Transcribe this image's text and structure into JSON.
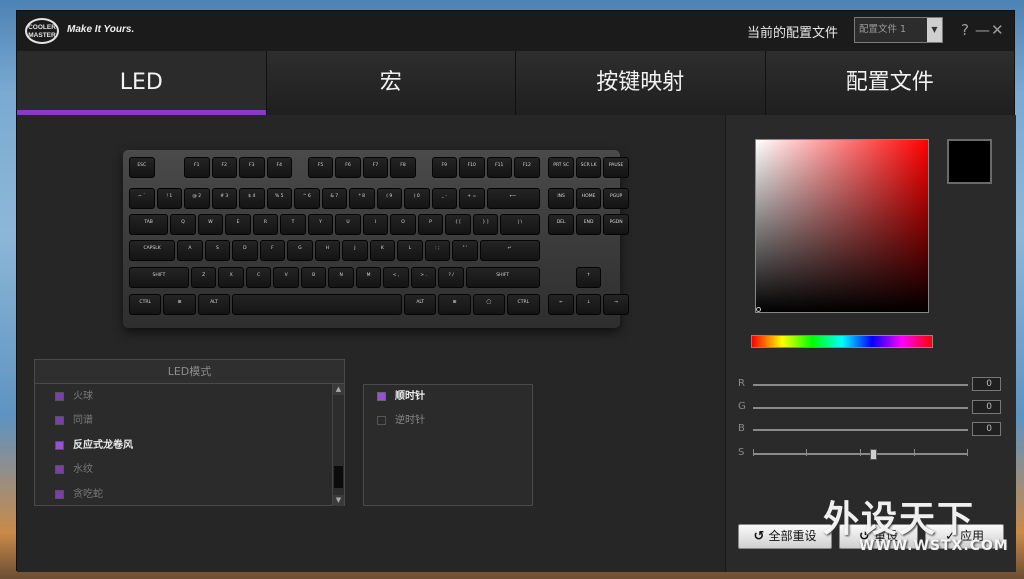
{
  "titlebar": {
    "logo_line1": "COOLER",
    "logo_line2": "MASTER",
    "slogan": "Make It Yours.",
    "profile_label": "当前的配置文件",
    "profile_value": "配置文件 1",
    "help": "?",
    "minimize": "—",
    "close": "✕"
  },
  "tabs": [
    "LED",
    "宏",
    "按键映射",
    "配置文件"
  ],
  "keyboard": {
    "rows": [
      [
        "ESC",
        "F1",
        "F2",
        "F3",
        "F4",
        "F5",
        "F6",
        "F7",
        "F8",
        "F9",
        "F10",
        "F11",
        "F12",
        "PRT SC",
        "SCR LK",
        "PAUSE"
      ],
      [
        "~ `",
        "! 1",
        "@ 2",
        "# 3",
        "$ 4",
        "% 5",
        "^ 6",
        "& 7",
        "* 8",
        "( 9",
        ") 0",
        "_ -",
        "+ =",
        "⟵",
        "INS",
        "HOME",
        "PGUP"
      ],
      [
        "TAB",
        "Q",
        "W",
        "E",
        "R",
        "T",
        "Y",
        "U",
        "I",
        "O",
        "P",
        "{ [",
        "} ]",
        "| \\",
        "DEL",
        "END",
        "PGDN"
      ],
      [
        "CAPSLK",
        "A",
        "S",
        "D",
        "F",
        "G",
        "H",
        "J",
        "K",
        "L",
        ": ;",
        "\" '",
        "↵"
      ],
      [
        "SHIFT",
        "Z",
        "X",
        "C",
        "V",
        "B",
        "N",
        "M",
        "< ,",
        "> .",
        "? /",
        "SHIFT",
        "↑"
      ],
      [
        "CTRL",
        "⊞",
        "ALT",
        "",
        "ALT",
        "⊞",
        "◯",
        "CTRL",
        "←",
        "↓",
        "→"
      ]
    ]
  },
  "led_mode": {
    "header": "LED模式",
    "items": [
      {
        "label": "火球",
        "selected": false
      },
      {
        "label": "同谱",
        "selected": false
      },
      {
        "label": "反应式龙卷风",
        "selected": true
      },
      {
        "label": "水纹",
        "selected": false
      },
      {
        "label": "贪吃蛇",
        "selected": false
      }
    ]
  },
  "direction": {
    "items": [
      {
        "label": "顺时针",
        "selected": true
      },
      {
        "label": "逆时针",
        "selected": false
      }
    ]
  },
  "color": {
    "current_hex": "#000000",
    "hue_start": "#ff0000",
    "accent": "#8a39c4",
    "sliders": [
      {
        "label": "R",
        "value": "0"
      },
      {
        "label": "G",
        "value": "0"
      },
      {
        "label": "B",
        "value": "0"
      },
      {
        "label": "S",
        "value": ""
      }
    ]
  },
  "buttons": {
    "reset_all": "全部重设",
    "reset": "重设",
    "apply": "应用"
  },
  "watermark": {
    "line1": "外设天下",
    "line2": "WWW.WSTX.COM"
  }
}
